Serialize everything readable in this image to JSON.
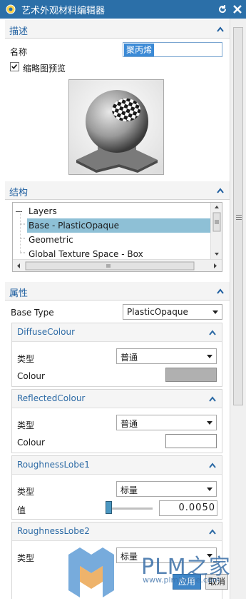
{
  "window": {
    "title": "艺术外观材料编辑器"
  },
  "describe": {
    "header": "描述",
    "name_label": "名称",
    "name_value": "聚丙烯",
    "thumbnail_label": "缩略图预览",
    "thumbnail_checked": true
  },
  "structure": {
    "header": "结构",
    "tree_items": [
      "Layers",
      "Base - PlasticOpaque",
      "Geometric",
      "Global Texture Space - Box"
    ],
    "selected_index": 1
  },
  "properties": {
    "header": "属性",
    "base_type_label": "Base Type",
    "base_type_value": "PlasticOpaque",
    "diffuse": {
      "header": "DiffuseColour",
      "type_label": "类型",
      "type_value": "普通",
      "colour_label": "Colour",
      "colour_hex": "#b0b0b0"
    },
    "reflected": {
      "header": "ReflectedColour",
      "type_label": "类型",
      "type_value": "普通",
      "colour_label": "Colour",
      "colour_hex": "#ffffff"
    },
    "roughness1": {
      "header": "RoughnessLobe1",
      "type_label": "类型",
      "type_value": "标量",
      "value_label": "值",
      "value_text": "0.0050",
      "slider_fraction": 0.005
    },
    "roughness2": {
      "header": "RoughnessLobe2",
      "type_label": "类型",
      "type_value": "标量"
    }
  },
  "buttons": {
    "apply": "应用",
    "cancel": "取消"
  },
  "watermark": {
    "brand": "PLM之家",
    "url": "www.plmhome.com"
  },
  "colors": {
    "titlebar": "#2b6fa8",
    "section_label": "#1f5fa0",
    "selection": "#8ec0d6"
  }
}
